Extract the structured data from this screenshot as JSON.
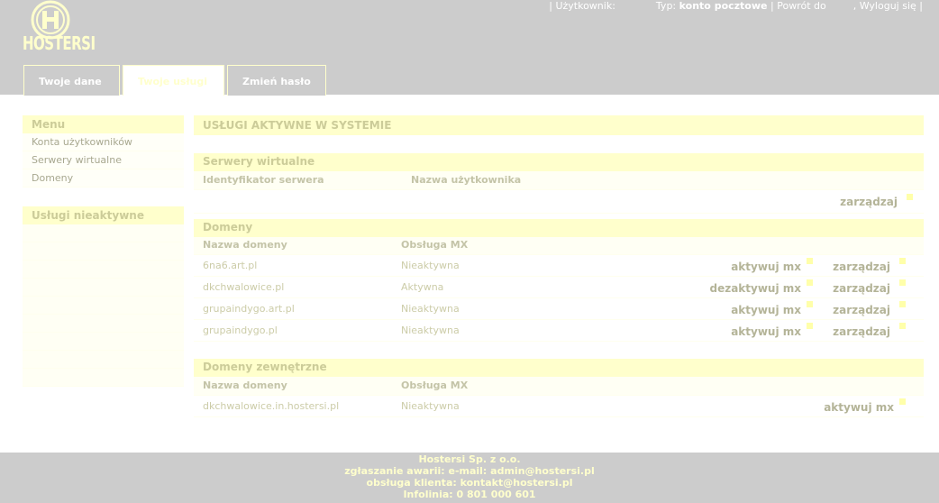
{
  "logo": {
    "text": "HOSTERSI"
  },
  "topbar": {
    "sep1": "|",
    "user_label": "Użytkownik:",
    "type_label": "Typ:",
    "type_value": "konto pocztowe",
    "sep2": "|",
    "back_link": "Powrót do",
    "logout_link": ", Wyloguj się",
    "sep3": "|"
  },
  "tabs": [
    {
      "label": "Twoje dane"
    },
    {
      "label": "Twoje usługi"
    },
    {
      "label": "Zmień hasło"
    }
  ],
  "sidebar": {
    "menu_title": "Menu",
    "items": [
      {
        "label": "Konta użytkowników"
      },
      {
        "label": "Serwery wirtualne"
      },
      {
        "label": "Domeny"
      }
    ],
    "inactive_title": "Usługi nieaktywne"
  },
  "main": {
    "title": "USŁUGI AKTYWNE W SYSTEMIE",
    "servers": {
      "title": "Serwery wirtualne",
      "col_id": "Identyfikator serwera",
      "col_user": "Nazwa użytkownika",
      "manage": "zarządzaj"
    },
    "domains": {
      "title": "Domeny",
      "col_name": "Nazwa domeny",
      "col_mx": "Obsługa MX",
      "rows": [
        {
          "name": "6na6.art.pl",
          "mx": "Nieaktywna",
          "action": "aktywuj mx",
          "manage": "zarządzaj"
        },
        {
          "name": "dkchwalowice.pl",
          "mx": "Aktywna",
          "action": "dezaktywuj mx",
          "manage": "zarządzaj"
        },
        {
          "name": "grupaindygo.art.pl",
          "mx": "Nieaktywna",
          "action": "aktywuj mx",
          "manage": "zarządzaj"
        },
        {
          "name": "grupaindygo.pl",
          "mx": "Nieaktywna",
          "action": "aktywuj mx",
          "manage": "zarządzaj"
        }
      ]
    },
    "external": {
      "title": "Domeny zewnętrzne",
      "col_name": "Nazwa domeny",
      "col_mx": "Obsługa MX",
      "rows": [
        {
          "name": "dkchwalowice.in.hostersi.pl",
          "mx": "Nieaktywna",
          "action": "aktywuj mx"
        }
      ]
    }
  },
  "footer": {
    "line1": "Hostersi Sp. z o.o.",
    "line2": "zgłaszanie awarii: e-mail: admin@hostersi.pl",
    "line3": "obsługa klienta: kontakt@hostersi.pl",
    "line4": "Infolinia: 0 801 000 601"
  },
  "colors": {
    "header_bg": "#cccccc",
    "accent_yellow": "#ffffcc",
    "square": "#ffffaa"
  }
}
